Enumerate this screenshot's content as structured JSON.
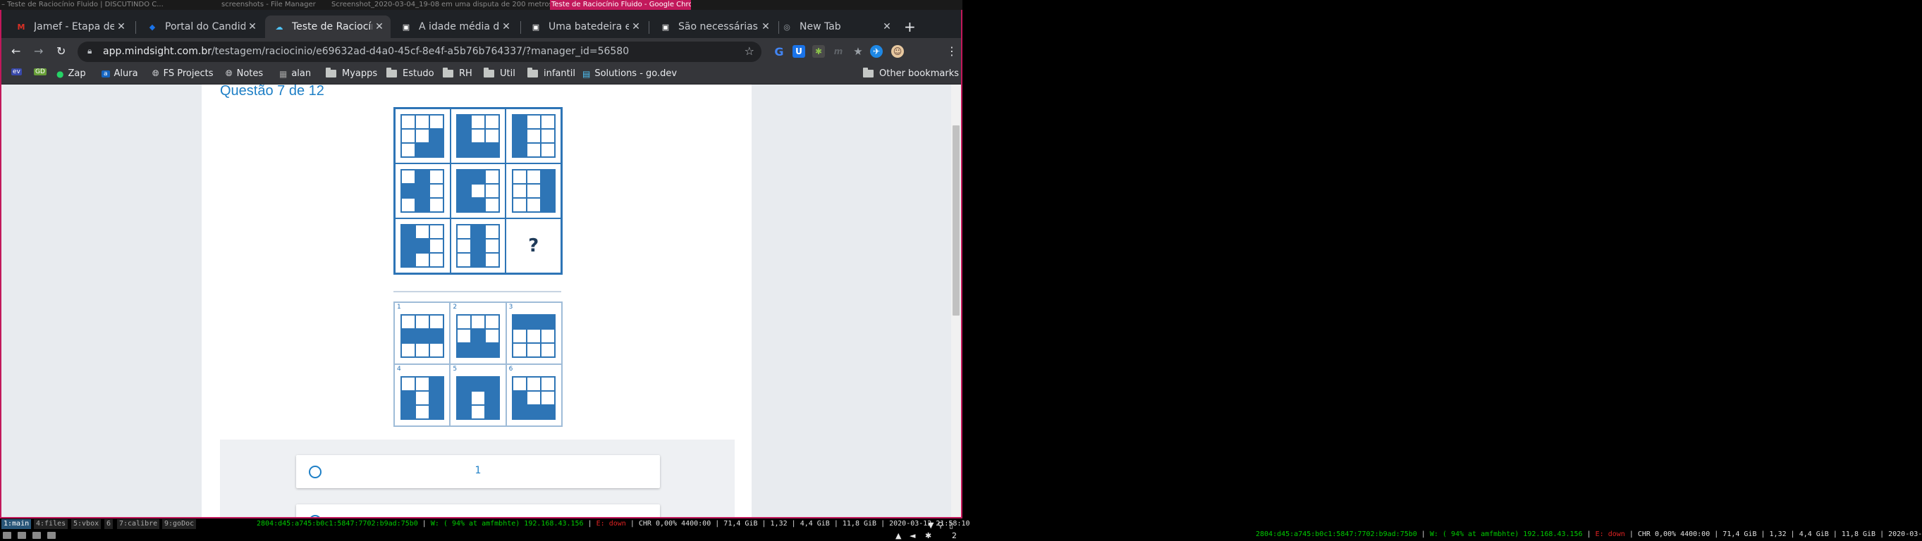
{
  "wm": {
    "window_titles": [
      "– Teste de Raciocínio Fluido | DISCUTINDO C...",
      "screenshots - File Manager",
      "Screenshot_2020-03-04_19-08-38.png - 2726 ×...",
      "em uma disputa de 200 metros rasos entre am...",
      "Teste de Raciocínio Fluido - Google Chrome"
    ]
  },
  "tabs": [
    {
      "label": "Jamef - Etapa de Te",
      "icon": "gmail-icon",
      "color": "#d93025"
    },
    {
      "label": "Portal do Candidato",
      "icon": "portal-icon",
      "color": "#1a73e8"
    },
    {
      "label": "Teste de Raciocínio",
      "icon": "mindsight-icon",
      "color": "#4fc3f7",
      "active": true
    },
    {
      "label": "A idade média de R",
      "icon": "brainly-icon",
      "color": "#ffffff"
    },
    {
      "label": "Uma batedeira esta",
      "icon": "brainly-icon",
      "color": "#ffffff"
    },
    {
      "label": "São necessárias 3,2",
      "icon": "brainly-icon",
      "color": "#ffffff"
    },
    {
      "label": "New Tab",
      "icon": "chrome-icon",
      "color": "#9aa0a6"
    }
  ],
  "toolbar": {
    "url_host": "app.mindsight.com.br",
    "url_path": "/testagem/raciocinio/e69632ad-d4a0-45cf-8e4f-a5b76b764337/?manager_id=56580"
  },
  "bookmarks": [
    {
      "label": "",
      "icon": "ev-icon"
    },
    {
      "label": "",
      "icon": "gd-icon"
    },
    {
      "label": "Zap",
      "icon": "whatsapp-icon"
    },
    {
      "label": "Alura",
      "icon": "alura-icon"
    },
    {
      "label": "FS Projects",
      "icon": "globe-icon"
    },
    {
      "label": "Notes",
      "icon": "globe-icon"
    },
    {
      "label": "alan",
      "icon": "picture-icon"
    },
    {
      "label": "Myapps",
      "icon": "folder-icon"
    },
    {
      "label": "Estudo",
      "icon": "folder-icon"
    },
    {
      "label": "RH",
      "icon": "folder-icon"
    },
    {
      "label": "Util",
      "icon": "folder-icon"
    },
    {
      "label": "infantil",
      "icon": "folder-icon"
    },
    {
      "label": "Solutions - go.dev",
      "icon": "go-icon"
    },
    {
      "label": "Other bookmarks",
      "icon": "folder-icon"
    }
  ],
  "page": {
    "question_title": "Questão 7 de 12",
    "missing_symbol": "?",
    "option_numbers": [
      "1",
      "2",
      "3",
      "4",
      "5",
      "6"
    ],
    "answer_options": [
      "1",
      ""
    ]
  },
  "matrix_patterns": [
    [
      0,
      0,
      0,
      0,
      0,
      1,
      0,
      1,
      1
    ],
    [
      1,
      0,
      0,
      1,
      0,
      0,
      1,
      1,
      1
    ],
    [
      1,
      0,
      0,
      1,
      0,
      0,
      1,
      0,
      0
    ],
    [
      0,
      1,
      0,
      1,
      1,
      0,
      0,
      1,
      0
    ],
    [
      1,
      1,
      0,
      1,
      0,
      0,
      1,
      1,
      0
    ],
    [
      0,
      0,
      1,
      0,
      0,
      1,
      0,
      0,
      1
    ],
    [
      1,
      0,
      0,
      1,
      1,
      0,
      1,
      0,
      0
    ],
    [
      0,
      1,
      0,
      0,
      1,
      0,
      0,
      1,
      0
    ]
  ],
  "option_patterns": [
    [
      0,
      0,
      0,
      1,
      1,
      1,
      0,
      0,
      0
    ],
    [
      0,
      0,
      0,
      0,
      1,
      0,
      1,
      1,
      1
    ],
    [
      1,
      1,
      1,
      0,
      0,
      0,
      0,
      0,
      0
    ],
    [
      0,
      0,
      1,
      1,
      0,
      1,
      1,
      0,
      1
    ],
    [
      1,
      1,
      1,
      1,
      0,
      1,
      1,
      0,
      1
    ],
    [
      0,
      0,
      0,
      1,
      0,
      0,
      1,
      1,
      1
    ]
  ],
  "statusbar": {
    "workspaces": [
      "1:main",
      "4:files",
      "5:vbox",
      "6",
      "7:calibre",
      "9:goDoc"
    ],
    "ipv6": "2804:d45:a745:b0c1:5847:7702:b9ad:75b0",
    "wifi": "W: ( 94% at amfmbhte) 192.168.43.156",
    "eth": "E: down",
    "cpu": "CHR 0,00% 4400:00",
    "disk": "71,4 GiB",
    "load": "1,32",
    "mem": "4,4 GiB | 11,8 GiB",
    "datetime": "2020-03-12 21:58:10",
    "right_datetime": "2020-03-12 21:58:10",
    "tray_num": "2"
  },
  "colors": {
    "accent": "#c2185b",
    "figure_blue": "#2e75b6",
    "link_blue": "#1e7fc6",
    "status_green": "#00cc00",
    "status_red": "#dd2222"
  }
}
